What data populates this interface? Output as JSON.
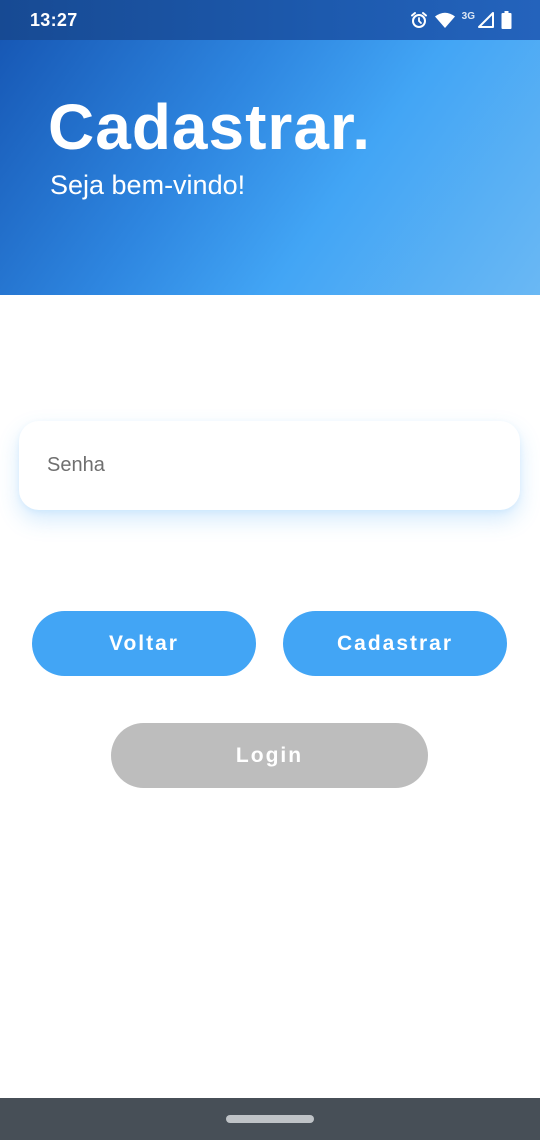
{
  "status_bar": {
    "time": "13:27",
    "network_label": "3G",
    "icons": [
      "alarm-icon",
      "wifi-icon",
      "cellular-signal-icon",
      "battery-icon"
    ]
  },
  "header": {
    "title": "Cadastrar.",
    "subtitle": "Seja bem-vindo!"
  },
  "form": {
    "password_placeholder": "Senha",
    "password_value": ""
  },
  "buttons": {
    "back_label": "Voltar",
    "register_label": "Cadastrar",
    "login_label": "Login"
  },
  "colors": {
    "primary": "#42a5f5",
    "header_gradient_start": "#1758b5",
    "header_gradient_end": "#6ab8f4",
    "disabled": "#bdbdbd",
    "nav_bar": "#474f57"
  },
  "nav_bar": {
    "icons": [
      "home-gesture-bar-icon"
    ]
  }
}
